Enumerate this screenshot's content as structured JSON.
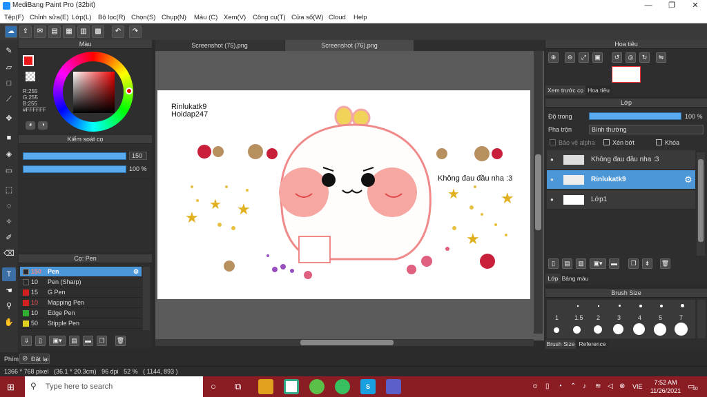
{
  "app_title": "MediBang Paint Pro (32bit)",
  "window_controls": {
    "minimize": "—",
    "maximize": "❐",
    "close": "✕"
  },
  "menu": [
    "Tệp(F)",
    "Chỉnh sửa(E)",
    "Lớp(L)",
    "Bộ lọc(R)",
    "Chọn(S)",
    "Chụp(N)",
    "Màu (C)",
    "Xem(V)",
    "Công cụ(T)",
    "Cửa sổ(W)",
    "Cloud",
    "Help"
  ],
  "color_panel": {
    "title": "Màu",
    "r": "R:255",
    "g": "G:255",
    "b": "B:255",
    "hex": "#FFFFFF",
    "primary_color": "#e81818"
  },
  "brush_control": {
    "title": "Kiểm soát cọ",
    "size": "150",
    "opacity": "100 %",
    "size_fraction": 1.0,
    "opacity_fraction": 1.0
  },
  "brush_panel": {
    "title": "Cọ: Pen",
    "items": [
      {
        "size": "150",
        "name": "Pen",
        "color": "#2a2a2a",
        "selected": true
      },
      {
        "size": "10",
        "name": "Pen (Sharp)",
        "color": "#2a2a2a"
      },
      {
        "size": "15",
        "name": "G Pen",
        "color": "#d42020"
      },
      {
        "size": "10",
        "name": "Mapping Pen",
        "color": "#d42020"
      },
      {
        "size": "10",
        "name": "Edge Pen",
        "color": "#30b030"
      },
      {
        "size": "50",
        "name": "Stipple Pen",
        "color": "#e0d020"
      }
    ]
  },
  "tabs": [
    "Screenshot (75).png",
    "Screenshot (76).png"
  ],
  "canvas": {
    "signature_1": "Rinlukatk9",
    "signature_2": "Hoidap247",
    "caption": "Không đau đầu nha :3"
  },
  "navigator": {
    "title": "Hoa tiêu",
    "tab_preview": "Xem trước cọ",
    "tab_nav": "Hoa tiêu"
  },
  "layer_panel": {
    "title": "Lớp",
    "opacity_label": "Độ trong",
    "opacity_value": "100 %",
    "blend_label": "Pha trộn",
    "blend_value": "Bình thường",
    "protect_alpha": "Bảo vệ alpha",
    "clipping": "Xén bớt",
    "lock": "Khóa",
    "layers": [
      {
        "name": "Không đau đầu nha :3",
        "selected": false
      },
      {
        "name": "Rinlukatk9",
        "selected": true
      },
      {
        "name": "Lớp1",
        "selected": false
      }
    ],
    "bottom_tabs": [
      "Lớp",
      "Bảng màu"
    ]
  },
  "brush_size_panel": {
    "title": "Brush Size",
    "sizes": [
      "1",
      "1.5",
      "2",
      "3",
      "4",
      "5",
      "7"
    ],
    "bottom_tabs": [
      "Brush Size",
      "Reference"
    ]
  },
  "bottom_bar": {
    "tab": "Phím",
    "reset": "Đặt lại"
  },
  "status": "1366 * 768 pixel   (36.1 * 20.3cm)   96 dpi   52 %   ( 1144, 893 )",
  "taskbar": {
    "search_placeholder": "Type here to search",
    "lang": "VIE",
    "time": "7:52 AM",
    "date": "11/26/2021",
    "notif": "10"
  }
}
